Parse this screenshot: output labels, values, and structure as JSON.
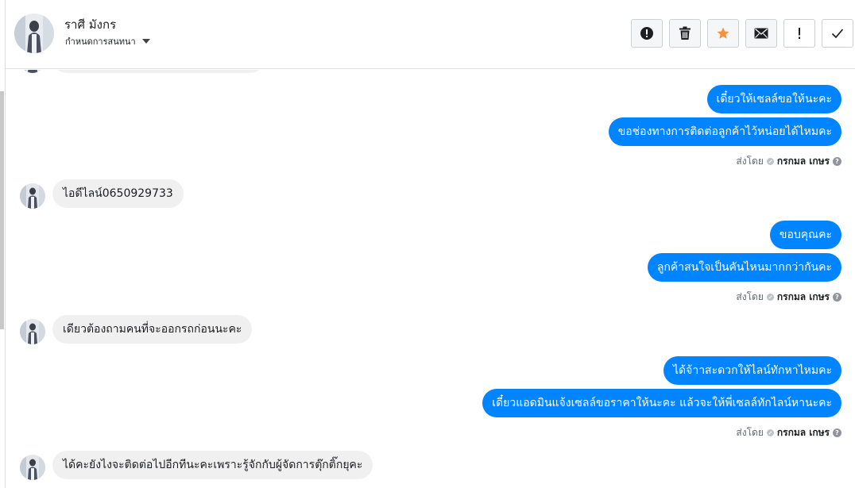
{
  "header": {
    "name": "ราศี มังกร",
    "subtitle": "กำหนดการสนทนา",
    "actions": [
      "spam-report",
      "delete",
      "star",
      "mark-unread",
      "follow-up",
      "done"
    ]
  },
  "messages": {
    "out_1": "เดี๋ยวให้เซลล์ขอให้นะคะ",
    "out_2": "ขอช่องทางการติดต่อลูกค้าไว้หน่อยได้ไหมคะ",
    "in_1": "ไอดีไลน์0650929733",
    "out_3": "ขอบคุณคะ",
    "out_4": "ลูกค้าสนใจเป็นคันไหนมากกว่ากันคะ",
    "in_2": "เดียวต้องถามคนที่จะออกรถก่อนนะคะ",
    "out_5": "ได้จ้าาสะดวกให้ไลน์ทักหาไหมคะ",
    "out_6": "เดี๋ยวแอดมินแจ้งเซลล์ขอราคาให้นะคะ  แล้วจะให้พี่เซลล์ทักไลน์หานะคะ",
    "in_3": "ได้คะยังไงจะติดต่อไปอีกทีนะคะเพราะรู้จักกับผู้จัดการตุ๊กติ๊กยุคะ"
  },
  "sent_by": {
    "label": "ส่งโดย",
    "name": "กรกมล เกษร",
    "help": "?"
  },
  "colors": {
    "outgoing_bubble": "#0084ff",
    "incoming_bubble": "#f1f0f0",
    "star_accent": "#f7923a"
  }
}
